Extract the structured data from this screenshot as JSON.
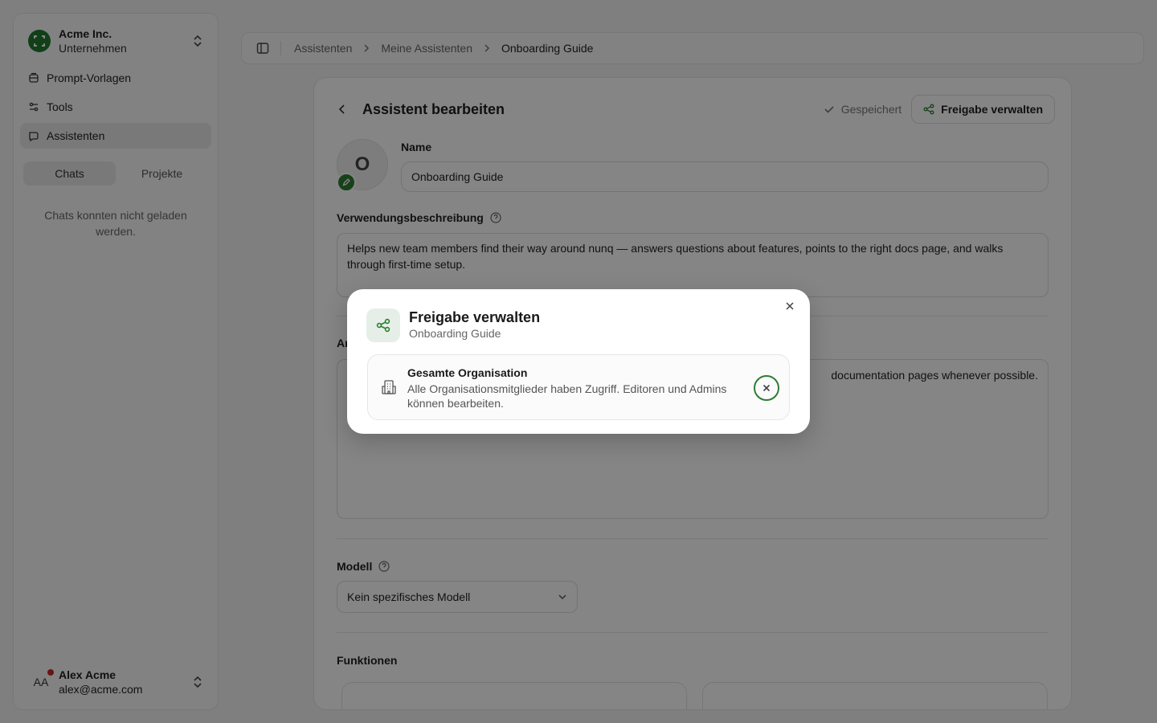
{
  "sidebar": {
    "org_name": "Acme Inc.",
    "org_sub": "Unternehmen",
    "items": [
      {
        "label": "Prompt-Vorlagen"
      },
      {
        "label": "Tools"
      },
      {
        "label": "Assistenten"
      }
    ],
    "tabs": [
      "Chats",
      "Projekte"
    ],
    "empty_message": "Chats konnten nicht geladen werden.",
    "user_initials": "AA",
    "user_name": "Alex Acme",
    "user_email": "alex@acme.com"
  },
  "breadcrumb": [
    "Assistenten",
    "Meine Assistenten",
    "Onboarding Guide"
  ],
  "editor": {
    "title": "Assistent bearbeiten",
    "saved_label": "Gespeichert",
    "share_button": "Freigabe verwalten",
    "avatar_letter": "O",
    "name_label": "Name",
    "name_value": "Onboarding Guide",
    "description_label": "Verwendungsbeschreibung",
    "description_value": "Helps new team members find their way around nunq — answers questions about features, points to the right docs page, and walks through first-time setup.",
    "instructions_label_partial": "An",
    "instructions_value_partial": "documentation pages whenever possible.",
    "model_label": "Modell",
    "model_value": "Kein spezifisches Modell",
    "functions_label": "Funktionen"
  },
  "modal": {
    "title": "Freigabe verwalten",
    "subtitle": "Onboarding Guide",
    "row_title": "Gesamte Organisation",
    "row_desc": "Alle Organisationsmitglieder haben Zugriff. Editoren und Admins können bearbeiten."
  },
  "colors": {
    "accent": "#2e7d32",
    "overlay": "rgba(0,0,0,0.48)"
  }
}
